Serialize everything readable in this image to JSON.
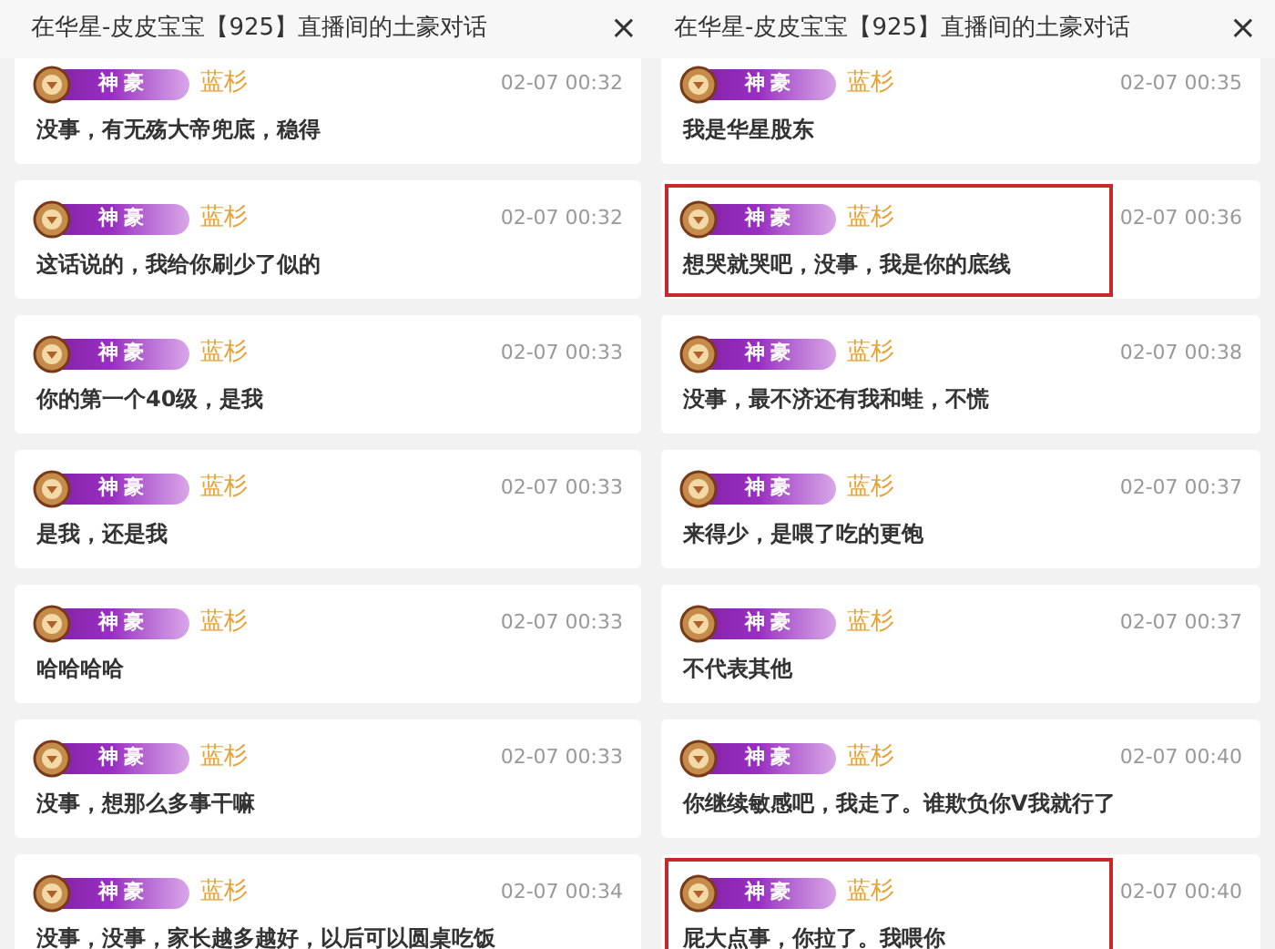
{
  "panels": [
    {
      "title": "在华星-皮皮宝宝【925】直播间的土豪对话",
      "close": "×",
      "messages": [
        {
          "badge": "神豪",
          "name": "蓝杉",
          "time": "02-07 00:32",
          "text": "没事，有无殇大帝兜底，稳得",
          "highlighted": false
        },
        {
          "badge": "神豪",
          "name": "蓝杉",
          "time": "02-07 00:32",
          "text": "这话说的，我给你刷少了似的",
          "highlighted": false
        },
        {
          "badge": "神豪",
          "name": "蓝杉",
          "time": "02-07 00:33",
          "text": "你的第一个40级，是我",
          "highlighted": false
        },
        {
          "badge": "神豪",
          "name": "蓝杉",
          "time": "02-07 00:33",
          "text": "是我，还是我",
          "highlighted": false
        },
        {
          "badge": "神豪",
          "name": "蓝杉",
          "time": "02-07 00:33",
          "text": "哈哈哈哈",
          "highlighted": false
        },
        {
          "badge": "神豪",
          "name": "蓝杉",
          "time": "02-07 00:33",
          "text": "没事，想那么多事干嘛",
          "highlighted": false
        },
        {
          "badge": "神豪",
          "name": "蓝杉",
          "time": "02-07 00:34",
          "text": "没事，没事，家长越多越好，以后可以圆桌吃饭",
          "highlighted": false
        }
      ]
    },
    {
      "title": "在华星-皮皮宝宝【925】直播间的土豪对话",
      "close": "×",
      "messages": [
        {
          "badge": "神豪",
          "name": "蓝杉",
          "time": "02-07 00:35",
          "text": "我是华星股东",
          "highlighted": false
        },
        {
          "badge": "神豪",
          "name": "蓝杉",
          "time": "02-07 00:36",
          "text": "想哭就哭吧，没事，我是你的底线",
          "highlighted": true
        },
        {
          "badge": "神豪",
          "name": "蓝杉",
          "time": "02-07 00:38",
          "text": "没事，最不济还有我和蛙，不慌",
          "highlighted": false
        },
        {
          "badge": "神豪",
          "name": "蓝杉",
          "time": "02-07 00:37",
          "text": "来得少，是喂了吃的更饱",
          "highlighted": false
        },
        {
          "badge": "神豪",
          "name": "蓝杉",
          "time": "02-07 00:37",
          "text": "不代表其他",
          "highlighted": false
        },
        {
          "badge": "神豪",
          "name": "蓝杉",
          "time": "02-07 00:40",
          "text": "你继续敏感吧，我走了。谁欺负你V我就行了",
          "highlighted": false
        },
        {
          "badge": "神豪",
          "name": "蓝杉",
          "time": "02-07 00:40",
          "text": "屁大点事，你拉了。我喂你",
          "highlighted": true
        }
      ]
    }
  ]
}
